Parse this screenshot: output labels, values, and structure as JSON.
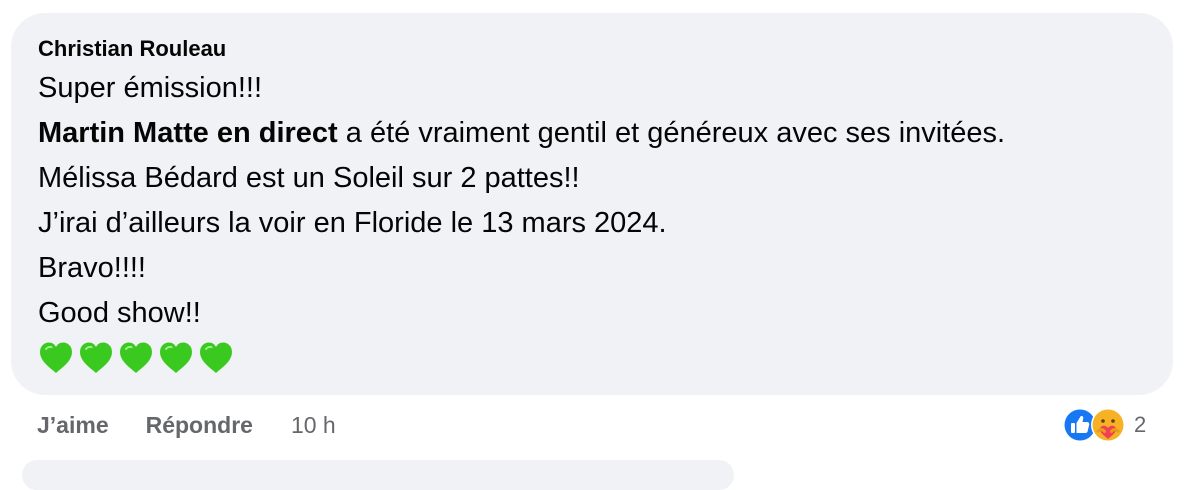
{
  "comment": {
    "author": "Christian Rouleau",
    "lines": {
      "l1": "Super émission!!!",
      "l2_mention": "Martin Matte en direct",
      "l2_rest": " a été vraiment gentil et généreux avec ses invitées.",
      "l3": "Mélissa Bédard est un Soleil sur 2 pattes!!",
      "l4": "J’irai d’ailleurs la voir en Floride le 13 mars 2024.",
      "l5": "Bravo!!!!",
      "l6": "Good show!!"
    },
    "emoji": [
      "green-heart",
      "green-heart",
      "green-heart",
      "green-heart",
      "green-heart"
    ]
  },
  "actions": {
    "like_label": "J’aime",
    "reply_label": "Répondre",
    "timestamp": "10 h"
  },
  "reactions": {
    "icons": [
      "like-icon",
      "care-icon"
    ],
    "count": "2"
  },
  "colors": {
    "bubble_bg": "#f0f2f5",
    "text": "#050505",
    "secondary_text": "#65676b",
    "like_blue": "#1877f2",
    "heart_green": "#3ac91f"
  }
}
